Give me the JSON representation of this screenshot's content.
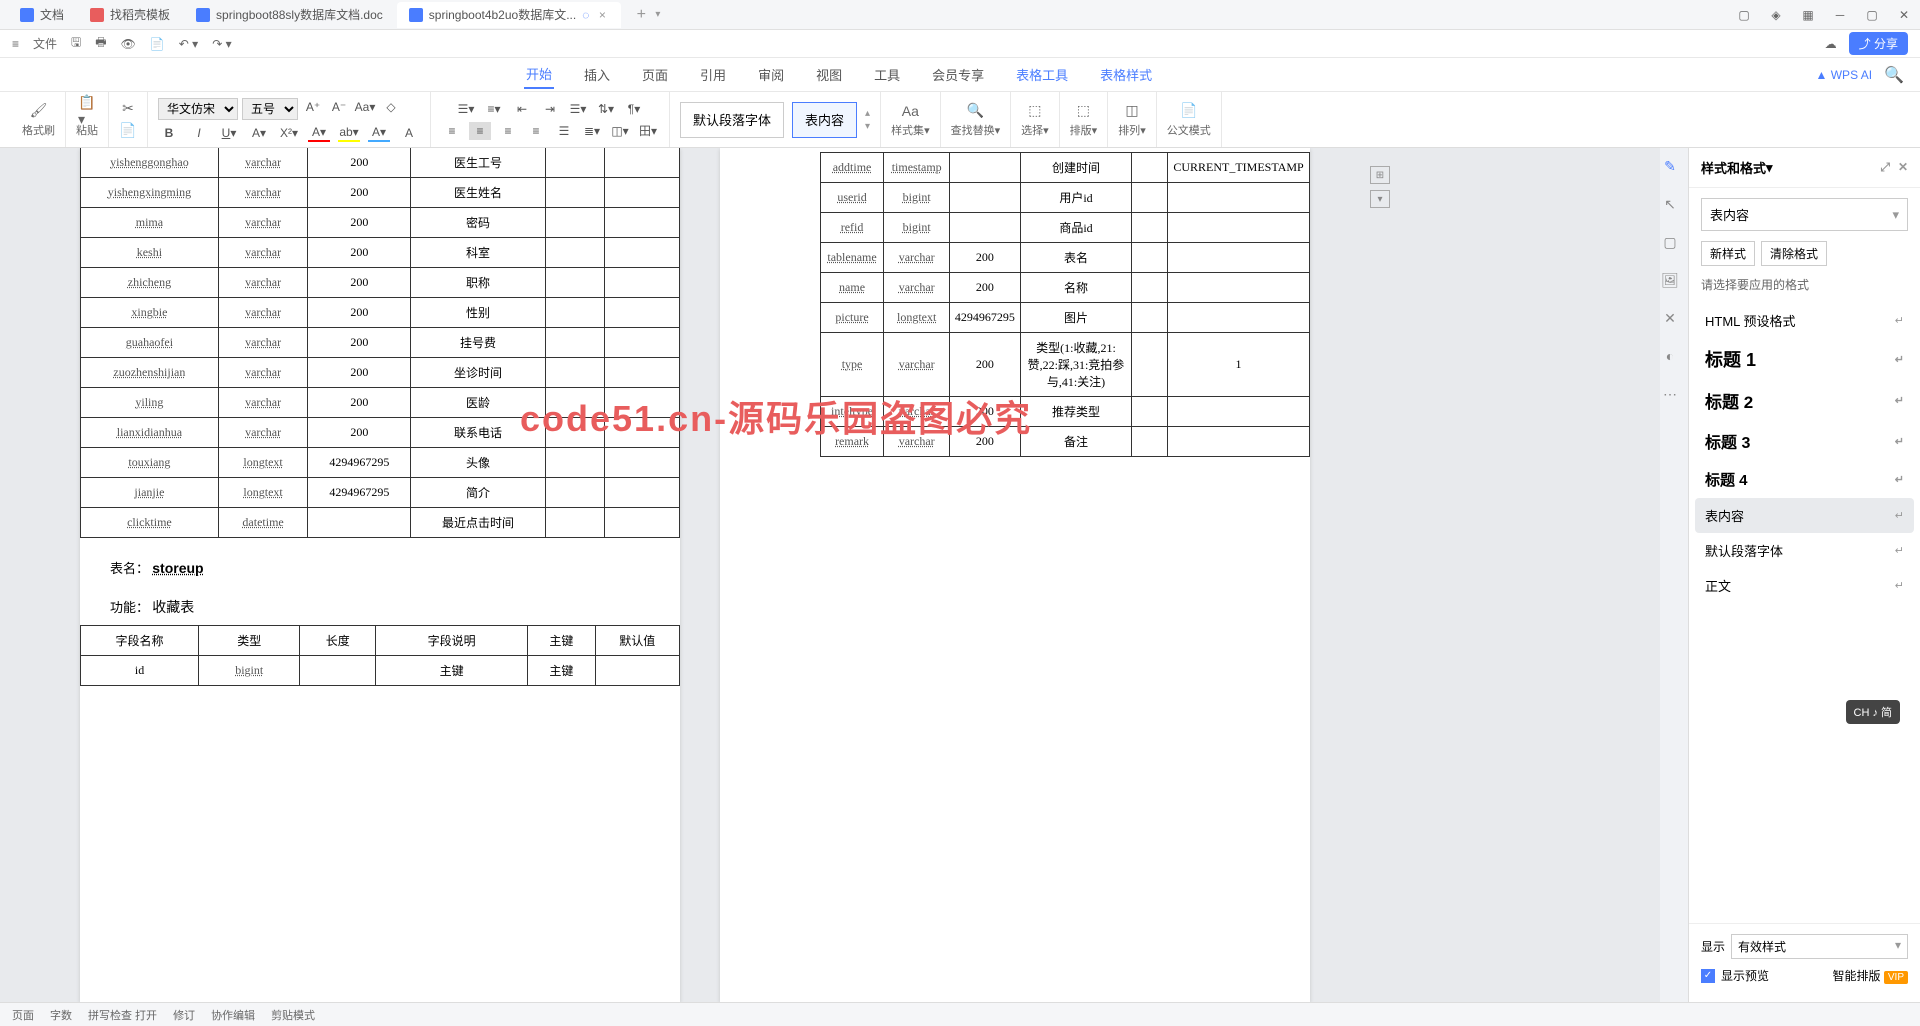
{
  "tabs": [
    {
      "label": "文档",
      "icon": "blue"
    },
    {
      "label": "找稻壳模板",
      "icon": "red"
    },
    {
      "label": "springboot88sly数据库文档.doc",
      "icon": "word"
    },
    {
      "label": "springboot4b2uo数据库文...",
      "icon": "word",
      "active": true
    }
  ],
  "filebar": {
    "menu": "≡",
    "file": "文件"
  },
  "menus": [
    "开始",
    "插入",
    "页面",
    "引用",
    "审阅",
    "视图",
    "工具",
    "会员专享"
  ],
  "menus_blue": [
    "表格工具",
    "表格样式"
  ],
  "ai_label": "WPS AI",
  "share_label": "分享",
  "toolbar": {
    "format_brush": "格式刷",
    "paste": "粘贴",
    "font": "华文仿宋",
    "size": "五号",
    "default_para": "默认段落字体",
    "table_content": "表内容",
    "style_set": "样式集",
    "find_replace": "查找替换",
    "select": "选择",
    "sort": "排版",
    "arrange": "排列",
    "official": "公文模式"
  },
  "left_table": {
    "rows": [
      {
        "f": "yishenggonghao",
        "t": "varchar",
        "l": "200",
        "d": "医生工号",
        "p": "",
        "df": ""
      },
      {
        "f": "yishengxingming",
        "t": "varchar",
        "l": "200",
        "d": "医生姓名",
        "p": "",
        "df": ""
      },
      {
        "f": "mima",
        "t": "varchar",
        "l": "200",
        "d": "密码",
        "p": "",
        "df": ""
      },
      {
        "f": "keshi",
        "t": "varchar",
        "l": "200",
        "d": "科室",
        "p": "",
        "df": ""
      },
      {
        "f": "zhicheng",
        "t": "varchar",
        "l": "200",
        "d": "职称",
        "p": "",
        "df": ""
      },
      {
        "f": "xingbie",
        "t": "varchar",
        "l": "200",
        "d": "性别",
        "p": "",
        "df": ""
      },
      {
        "f": "guahaofei",
        "t": "varchar",
        "l": "200",
        "d": "挂号费",
        "p": "",
        "df": ""
      },
      {
        "f": "zuozhenshijian",
        "t": "varchar",
        "l": "200",
        "d": "坐诊时间",
        "p": "",
        "df": ""
      },
      {
        "f": "yiling",
        "t": "varchar",
        "l": "200",
        "d": "医龄",
        "p": "",
        "df": ""
      },
      {
        "f": "lianxidianhua",
        "t": "varchar",
        "l": "200",
        "d": "联系电话",
        "p": "",
        "df": ""
      },
      {
        "f": "touxiang",
        "t": "longtext",
        "l": "4294967295",
        "d": "头像",
        "p": "",
        "df": ""
      },
      {
        "f": "jianjie",
        "t": "longtext",
        "l": "4294967295",
        "d": "简介",
        "p": "",
        "df": ""
      },
      {
        "f": "clicktime",
        "t": "datetime",
        "l": "",
        "d": "最近点击时间",
        "p": "",
        "df": ""
      }
    ],
    "table_name_label": "表名：",
    "table_name": "storeup",
    "func_label": "功能：",
    "func_value": "收藏表",
    "headers": [
      "字段名称",
      "类型",
      "长度",
      "字段说明",
      "主键",
      "默认值"
    ],
    "row2": {
      "f": "id",
      "t": "bigint",
      "l": "",
      "d": "主键",
      "p": "主键",
      "df": ""
    }
  },
  "right_table": {
    "rows": [
      {
        "f": "addtime",
        "t": "timestamp",
        "l": "",
        "d": "创建时间",
        "p": "",
        "df": "CURRENT_TIMESTAMP"
      },
      {
        "f": "userid",
        "t": "bigint",
        "l": "",
        "d": "用户id",
        "p": "",
        "df": ""
      },
      {
        "f": "refid",
        "t": "bigint",
        "l": "",
        "d": "商品id",
        "p": "",
        "df": ""
      },
      {
        "f": "tablename",
        "t": "varchar",
        "l": "200",
        "d": "表名",
        "p": "",
        "df": ""
      },
      {
        "f": "name",
        "t": "varchar",
        "l": "200",
        "d": "名称",
        "p": "",
        "df": ""
      },
      {
        "f": "picture",
        "t": "longtext",
        "l": "4294967295",
        "d": "图片",
        "p": "",
        "df": ""
      },
      {
        "f": "type",
        "t": "varchar",
        "l": "200",
        "d": "类型(1:收藏,21:赞,22:踩,31:竞拍参与,41:关注)",
        "p": "",
        "df": "1"
      },
      {
        "f": "inteltype",
        "t": "varchar",
        "l": "200",
        "d": "推荐类型",
        "p": "",
        "df": ""
      },
      {
        "f": "remark",
        "t": "varchar",
        "l": "200",
        "d": "备注",
        "p": "",
        "df": ""
      }
    ]
  },
  "panel": {
    "title": "样式和格式",
    "current": "表内容",
    "new_style": "新样式",
    "clear_format": "清除格式",
    "hint": "请选择要应用的格式",
    "styles": [
      {
        "label": "HTML 预设格式",
        "cls": ""
      },
      {
        "label": "标题 1",
        "cls": "h1"
      },
      {
        "label": "标题 2",
        "cls": "h2"
      },
      {
        "label": "标题 3",
        "cls": "h3"
      },
      {
        "label": "标题 4",
        "cls": "h4"
      },
      {
        "label": "表内容",
        "cls": "",
        "selected": true
      },
      {
        "label": "默认段落字体",
        "cls": ""
      },
      {
        "label": "正文",
        "cls": ""
      }
    ],
    "show_label": "显示",
    "show_value": "有效样式",
    "preview_label": "显示预览",
    "smart_layout": "智能排版",
    "vip": "VIP"
  },
  "watermark": "code51.cn-源码乐园盗图必究",
  "ime": "CH ♪ 简",
  "statusbar": {
    "page": "页面 ",
    "words": "字数 ",
    "check": "拼写检查 打开",
    "rev": "修订",
    "coop": "协作编辑",
    "clip": "剪贴模式"
  }
}
